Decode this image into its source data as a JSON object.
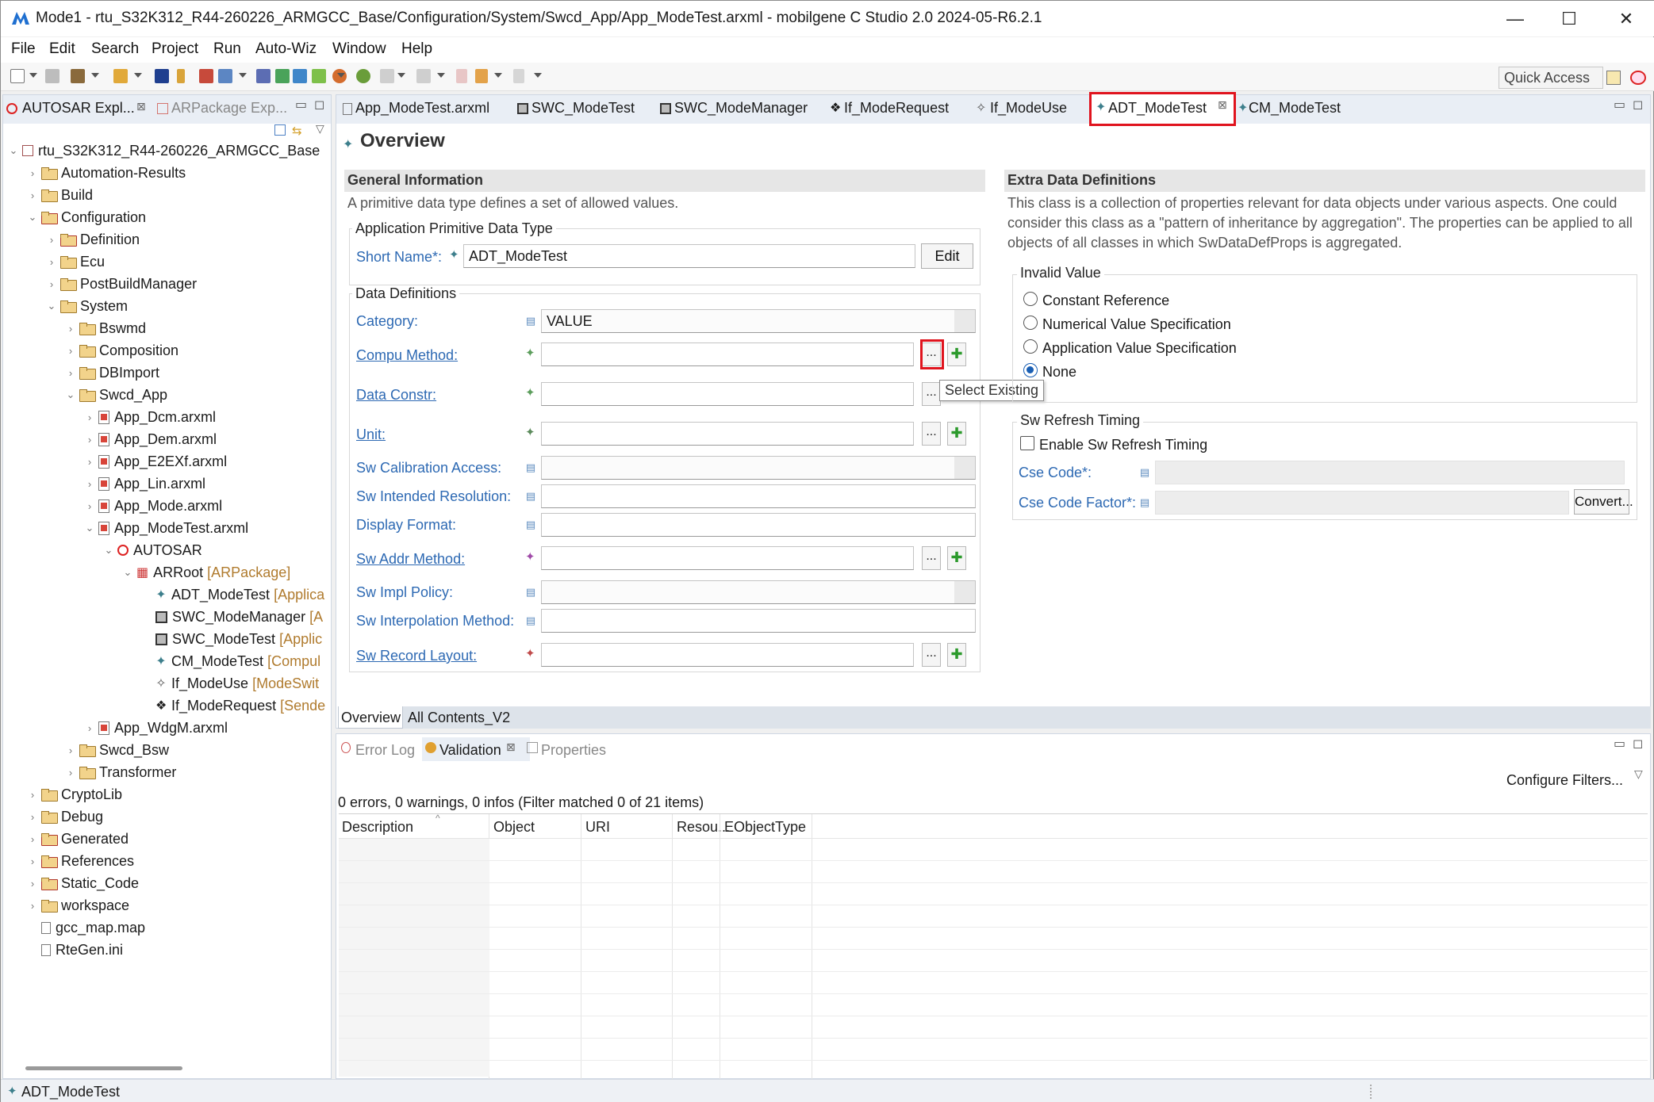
{
  "window": {
    "title": "Mode1 - rtu_S32K312_R44-260226_ARMGCC_Base/Configuration/System/Swcd_App/App_ModeTest.arxml - mobilgene C Studio 2.0 2024-05-R6.2.1",
    "minimize": "—",
    "maximize": "☐",
    "close": "✕"
  },
  "menu": [
    "File",
    "Edit",
    "Search",
    "Project",
    "Run",
    "Auto-Wiz",
    "Window",
    "Help"
  ],
  "toolbar": {
    "quick_access": "Quick Access"
  },
  "explorer": {
    "tab_active": "AUTOSAR Expl...",
    "tab_inactive": "ARPackage Exp...",
    "tree": [
      {
        "label": "rtu_S32K312_R44-260226_ARMGCC_Base"
      },
      {
        "label": "Automation-Results"
      },
      {
        "label": "Build"
      },
      {
        "label": "Configuration"
      },
      {
        "label": "Definition"
      },
      {
        "label": "Ecu"
      },
      {
        "label": "PostBuildManager"
      },
      {
        "label": "System"
      },
      {
        "label": "Bswmd"
      },
      {
        "label": "Composition"
      },
      {
        "label": "DBImport"
      },
      {
        "label": "Swcd_App"
      },
      {
        "label": "App_Dcm.arxml"
      },
      {
        "label": "App_Dem.arxml"
      },
      {
        "label": "App_E2EXf.arxml"
      },
      {
        "label": "App_Lin.arxml"
      },
      {
        "label": "App_Mode.arxml"
      },
      {
        "label": "App_ModeTest.arxml"
      },
      {
        "label": "AUTOSAR"
      },
      {
        "label": "ARRoot",
        "tag": "[ARPackage]"
      },
      {
        "label": "ADT_ModeTest",
        "tag": "[Applica"
      },
      {
        "label": "SWC_ModeManager",
        "tag": "[A"
      },
      {
        "label": "SWC_ModeTest",
        "tag": "[Applic"
      },
      {
        "label": "CM_ModeTest",
        "tag": "[Compul"
      },
      {
        "label": "If_ModeUse",
        "tag": "[ModeSwit"
      },
      {
        "label": "If_ModeRequest",
        "tag": "[Sende"
      },
      {
        "label": "App_WdgM.arxml"
      },
      {
        "label": "Swcd_Bsw"
      },
      {
        "label": "Transformer"
      },
      {
        "label": "CryptoLib"
      },
      {
        "label": "Debug"
      },
      {
        "label": "Generated"
      },
      {
        "label": "References"
      },
      {
        "label": "Static_Code"
      },
      {
        "label": "workspace"
      },
      {
        "label": "gcc_map.map"
      },
      {
        "label": "RteGen.ini"
      }
    ]
  },
  "editor": {
    "tabs": [
      "App_ModeTest.arxml",
      "SWC_ModeTest",
      "SWC_ModeManager",
      "If_ModeRequest",
      "If_ModeUse",
      "ADT_ModeTest",
      "CM_ModeTest"
    ],
    "overview_title": "Overview",
    "general": {
      "header": "General Information",
      "desc": "A primitive data type defines a set of allowed values.",
      "group": "Application Primitive Data Type",
      "short_name_label": "Short Name*:",
      "short_name_value": "ADT_ModeTest",
      "edit_button": "Edit"
    },
    "data_defs": {
      "group": "Data Definitions",
      "category_label": "Category:",
      "category_value": "VALUE",
      "compu_label": "Compu Method:",
      "constr_label": "Data Constr:",
      "unit_label": "Unit:",
      "calib_label": "Sw Calibration Access:",
      "resolution_label": "Sw Intended Resolution:",
      "display_label": "Display Format:",
      "addr_label": "Sw Addr Method:",
      "impl_label": "Sw Impl Policy:",
      "interp_label": "Sw Interpolation Method:",
      "record_label": "Sw Record Layout:",
      "browse": "...",
      "add": "✚"
    },
    "tooltip": "Select Existing",
    "extra": {
      "header": "Extra Data Definitions",
      "desc": "This class is a collection of properties relevant for data objects under various aspects. One could consider this class as a \"pattern of inheritance by aggregation\". The properties can be applied to all objects of all classes in which SwDataDefProps is aggregated.",
      "invalid_group": "Invalid Value",
      "radio_options": [
        "Constant Reference",
        "Numerical Value Specification",
        "Application Value Specification",
        "None"
      ],
      "radio_selected": "None",
      "refresh_group": "Sw Refresh Timing",
      "enable_refresh": "Enable Sw Refresh Timing",
      "cse_code": "Cse Code*:",
      "cse_factor": "Cse Code Factor*:",
      "convert_button": "Convert..."
    },
    "bottom_tabs": [
      "Overview",
      "All Contents_V2"
    ]
  },
  "validation": {
    "tabs": [
      "Error Log",
      "Validation",
      "Properties"
    ],
    "configure": "Configure Filters...",
    "summary": "0 errors, 0 warnings, 0 infos (Filter matched 0 of 21 items)",
    "columns": [
      "Description",
      "Object",
      "URI",
      "Resou...",
      "EObjectType"
    ]
  },
  "status": {
    "text": "ADT_ModeTest"
  }
}
